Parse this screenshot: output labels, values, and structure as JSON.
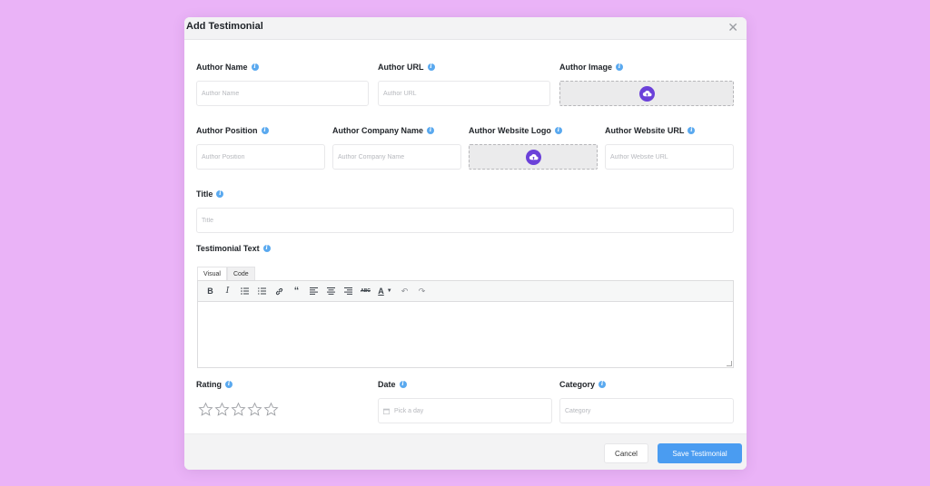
{
  "modal": {
    "title": "Add Testimonial",
    "close_icon": "close-icon"
  },
  "fields": {
    "author_name": {
      "label": "Author Name",
      "placeholder": "Author Name"
    },
    "author_url": {
      "label": "Author URL",
      "placeholder": "Author URL"
    },
    "author_image": {
      "label": "Author Image"
    },
    "author_position": {
      "label": "Author Position",
      "placeholder": "Author Position"
    },
    "author_company": {
      "label": "Author Company Name",
      "placeholder": "Author Company Name"
    },
    "author_logo": {
      "label": "Author Website Logo"
    },
    "author_website": {
      "label": "Author Website URL",
      "placeholder": "Author Website URL"
    },
    "title": {
      "label": "Title",
      "placeholder": "Title"
    },
    "testimonial_text": {
      "label": "Testimonial Text"
    },
    "rating": {
      "label": "Rating",
      "value": 0,
      "max": 5
    },
    "date": {
      "label": "Date",
      "placeholder": "Pick a day"
    },
    "category": {
      "label": "Category",
      "placeholder": "Category"
    }
  },
  "editor": {
    "tabs": [
      "Visual",
      "Code"
    ],
    "active_tab": "Visual",
    "toolbar": [
      "bold-icon",
      "italic-icon",
      "bullet-list-icon",
      "numbered-list-icon",
      "link-icon",
      "blockquote-icon",
      "align-left-icon",
      "align-center-icon",
      "align-right-icon",
      "strikethrough-icon",
      "text-color-icon",
      "undo-icon",
      "redo-icon"
    ]
  },
  "footer": {
    "cancel_label": "Cancel",
    "save_label": "Save Testimonial"
  },
  "colors": {
    "background": "#eab3f7",
    "accent": "#4a9cf1",
    "upload_icon": "#6b41d9",
    "info_icon": "#5aa9ef"
  }
}
